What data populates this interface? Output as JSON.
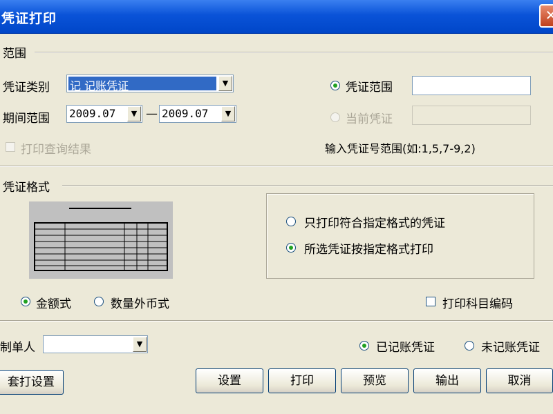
{
  "window": {
    "title": "凭证打印",
    "close_symbol": "✕"
  },
  "range_section": {
    "heading": "范围",
    "voucher_type_label": "凭证类别",
    "voucher_type_value": "记 记账凭证",
    "period_label": "期间范围",
    "period_from": "2009.07",
    "period_sep": "—",
    "period_to": "2009.07",
    "print_query_label": "打印查询结果",
    "voucher_range_label": "凭证范围",
    "voucher_range_value": "",
    "current_voucher_label": "当前凭证",
    "current_voucher_value": "",
    "hint": "输入凭证号范围(如:1,5,7-9,2)"
  },
  "format_section": {
    "heading": "凭证格式",
    "opt_only_matching": "只打印符合指定格式的凭证",
    "opt_all_by_format": "所选凭证按指定格式打印",
    "amount_style": "金额式",
    "quantity_style": "数量外币式",
    "print_subject_code": "打印科目编码"
  },
  "bottom": {
    "creator_label": "制单人",
    "creator_value": "",
    "posted_label": "已记账凭证",
    "unposted_label": "未记账凭证"
  },
  "buttons": {
    "template_setup": "套打设置",
    "settings": "设置",
    "print": "打印",
    "preview": "预览",
    "export": "输出",
    "cancel": "取消"
  },
  "icons": {
    "dropdown": "▼"
  },
  "colors": {
    "titlebar": "#0a53d8",
    "selection": "#316ac5",
    "radio_dot": "#21a121"
  }
}
